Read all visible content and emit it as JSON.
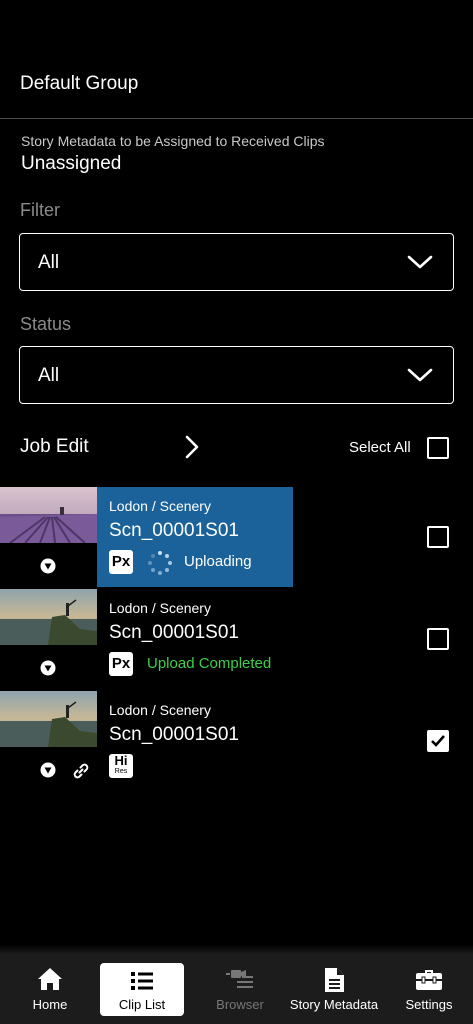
{
  "group": {
    "title": "Default Group"
  },
  "story": {
    "label": "Story Metadata to be Assigned to Received Clips",
    "value": "Unassigned"
  },
  "filter": {
    "label": "Filter",
    "value": "All"
  },
  "status_filter": {
    "label": "Status",
    "value": "All"
  },
  "job_edit": {
    "label": "Job Edit",
    "select_all_label": "Select All",
    "select_all_checked": false
  },
  "clips": [
    {
      "path": "Lodon / Scenery",
      "name": "Scn_00001S01",
      "badge": "Px",
      "status": "Uploading",
      "status_color": "#ffffff",
      "highlighted": true,
      "linked": false,
      "checked": false
    },
    {
      "path": "Lodon / Scenery",
      "name": "Scn_00001S01",
      "badge": "Px",
      "status": "Upload Completed",
      "status_color": "#3ecf4a",
      "highlighted": false,
      "linked": false,
      "checked": false
    },
    {
      "path": "Lodon / Scenery",
      "name": "Scn_00001S01",
      "badge": "Hi Res",
      "badge_top": "Hi",
      "badge_bottom": "Res",
      "status": "",
      "highlighted": false,
      "linked": true,
      "checked": true
    }
  ],
  "nav": [
    {
      "label": "Home",
      "icon": "home-icon"
    },
    {
      "label": "Clip List",
      "icon": "list-icon",
      "active": true
    },
    {
      "label": "Browser",
      "icon": "browser-icon",
      "disabled": true
    },
    {
      "label": "Story Metadata",
      "icon": "document-icon"
    },
    {
      "label": "Settings",
      "icon": "toolbox-icon"
    }
  ],
  "colors": {
    "highlight": "#1a6299",
    "success": "#3ecf4a",
    "background": "#000000",
    "navbar": "#1c1c1c"
  }
}
